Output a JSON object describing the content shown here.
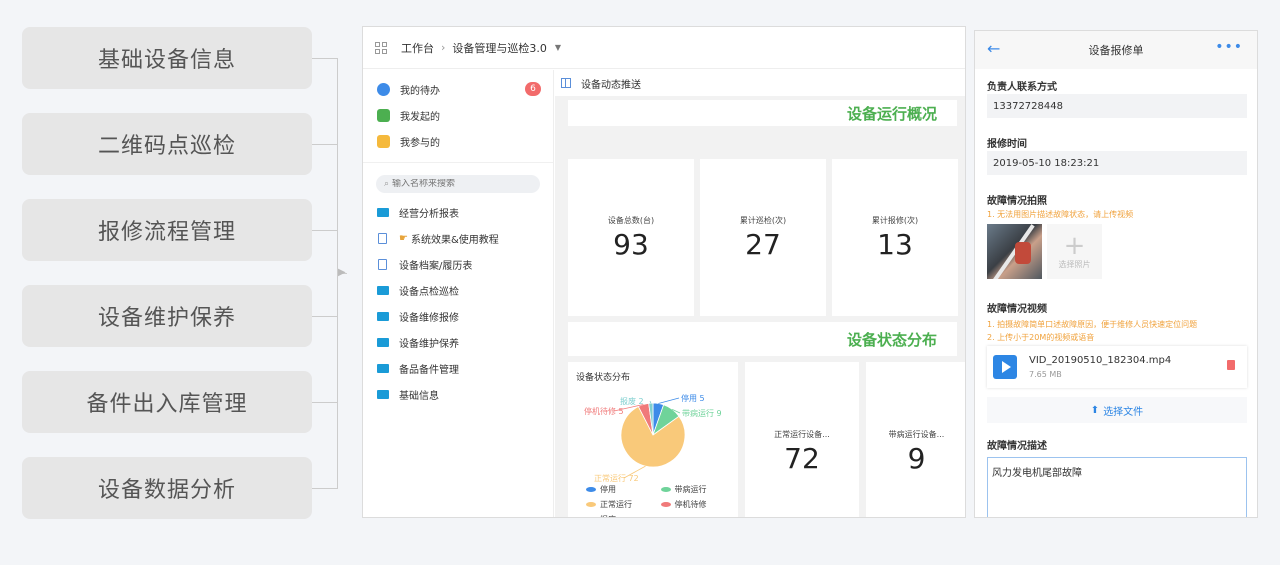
{
  "features": [
    "基础设备信息",
    "二维码点巡检",
    "报修流程管理",
    "设备维护保养",
    "备件出入库管理",
    "设备数据分析"
  ],
  "desktop": {
    "breadcrumb": {
      "root": "工作台",
      "current": "设备管理与巡检3.0"
    },
    "sidebar": {
      "top_items": [
        {
          "label": "我的待办",
          "badge": "6",
          "color": "#3d8be8"
        },
        {
          "label": "我发起的",
          "color": "#4caf50"
        },
        {
          "label": "我参与的",
          "color": "#f5b93c"
        }
      ],
      "search_placeholder": "输入名称来搜索",
      "items": [
        {
          "label": "经营分析报表",
          "icon": "folder"
        },
        {
          "label": "系统效果&使用教程",
          "icon": "doc"
        },
        {
          "label": "设备档案/履历表",
          "icon": "doc"
        },
        {
          "label": "设备点检巡检",
          "icon": "folder"
        },
        {
          "label": "设备维修报修",
          "icon": "folder"
        },
        {
          "label": "设备维护保养",
          "icon": "folder"
        },
        {
          "label": "备品备件管理",
          "icon": "folder"
        },
        {
          "label": "基础信息",
          "icon": "folder"
        }
      ]
    },
    "content": {
      "title": "设备动态推送",
      "section1": "设备运行概况",
      "stats": [
        {
          "label": "设备总数(台)",
          "value": "93"
        },
        {
          "label": "累计巡检(次)",
          "value": "27"
        },
        {
          "label": "累计报修(次)",
          "value": "13"
        }
      ],
      "section2": "设备状态分布",
      "status_cards": [
        {
          "label": "正常运行设备...",
          "value": "72"
        },
        {
          "label": "带病运行设备...",
          "value": "9"
        }
      ]
    }
  },
  "chart_data": {
    "type": "pie",
    "title": "设备状态分布",
    "slices": [
      {
        "label": "停用",
        "value": 5,
        "color": "#3d8be8"
      },
      {
        "label": "带病运行",
        "value": 9,
        "color": "#6fd39a"
      },
      {
        "label": "正常运行",
        "value": 72,
        "color": "#f9c97a"
      },
      {
        "label": "停机待修",
        "value": 5,
        "color": "#f07a7a"
      },
      {
        "label": "报废",
        "value": 2,
        "color": "#7ecfcf"
      }
    ],
    "slice_labels": [
      "停用 5",
      "带病运行 9",
      "正常运行 72",
      "停机待修 5",
      "报废 2"
    ],
    "legend": [
      "停用",
      "带病运行",
      "正常运行",
      "停机待修",
      "报废"
    ]
  },
  "phone": {
    "title": "设备报修单",
    "contact_label": "负责人联系方式",
    "contact_value": "13372728448",
    "time_label": "报修时间",
    "time_value": "2019-05-10 18:23:21",
    "photo_label": "故障情况拍照",
    "photo_hint": "1. 无法用图片描述故障状态，请上传视频",
    "add_photo": "选择照片",
    "video_label": "故障情况视频",
    "video_hint1": "1. 拍摄故障简单口述故障原因，便于维修人员快速定位问题",
    "video_hint2": "2. 上传小于20M的视频或语音",
    "file_name": "VID_20190510_182304.mp4",
    "file_size": "7.65 MB",
    "upload_label": "选择文件",
    "desc_label": "故障情况描述",
    "desc_value": "风力发电机尾部故障"
  }
}
